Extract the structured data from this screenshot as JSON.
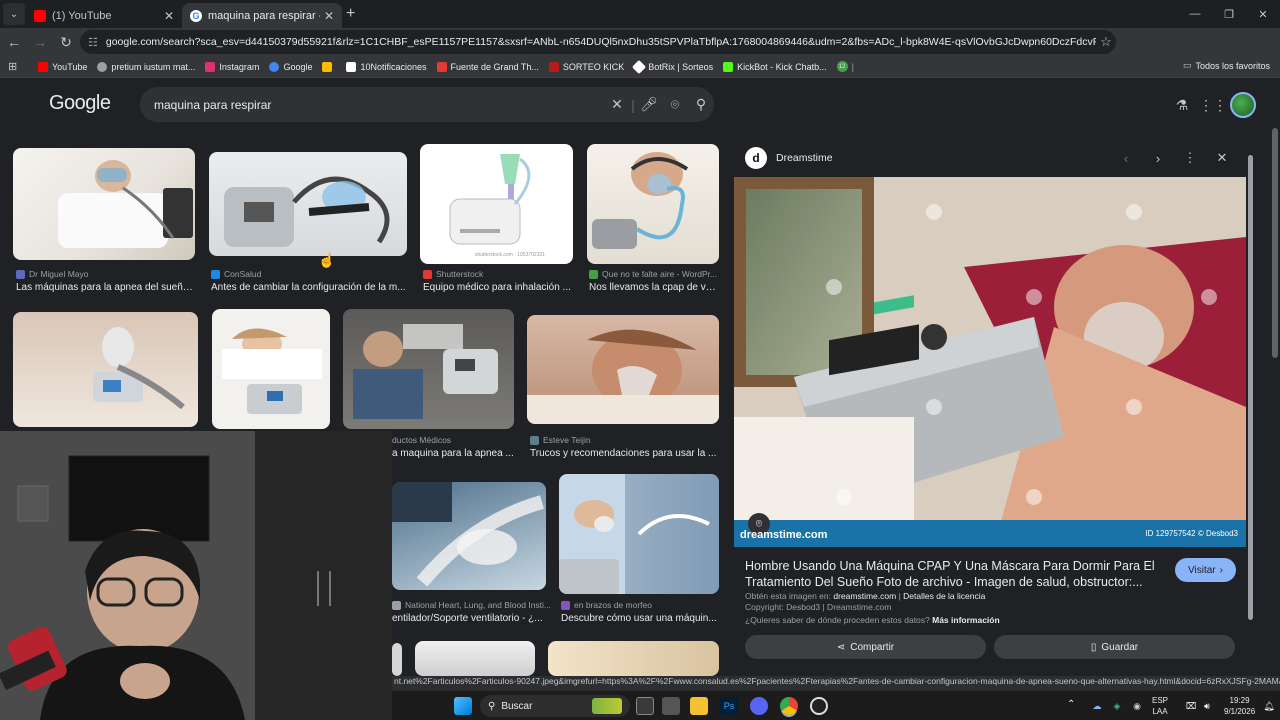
{
  "browser": {
    "tabs": [
      {
        "title": "(1) YouTube",
        "favicon_color": "#ff0000"
      },
      {
        "title": "maquina para respirar - Buscar",
        "favicon_color": "#4285f4"
      }
    ],
    "new_tab": "+",
    "url": "google.com/search?sca_esv=d44150379d55921f&rlz=1C1CHBF_esPE1157PE1157&sxsrf=ANbL-n654DUQl5nxDhu35tSPVPlaTbflpA:1768004869446&udm=2&fbs=ADc_l-bpk8W4E-qsVlOvbGJcDwpn60DczFdcvPnuv8WQohHLTa-EmKihfPCc..."
  },
  "bookmarks": [
    {
      "label": "YouTube",
      "color": "#ff0000"
    },
    {
      "label": "pretium iustum mat...",
      "color": "#9aa0a6"
    },
    {
      "label": "Instagram",
      "color": "#e1306c"
    },
    {
      "label": "Google",
      "color": "#4285f4"
    },
    {
      "label": "",
      "color": "#fbbc04"
    },
    {
      "label": "10Notificaciones",
      "color": "#ffffff"
    },
    {
      "label": "Fuente de Grand Th...",
      "color": "#e53935"
    },
    {
      "label": "SORTEO KICK",
      "color": "#b71c1c"
    },
    {
      "label": "BotRix | Sorteos",
      "color": "#ffffff"
    },
    {
      "label": "KickBot - Kick Chatb...",
      "color": "#53fc18"
    },
    {
      "label": "",
      "color": "#43a047"
    }
  ],
  "bookmarks_badge": "12",
  "bookmarks_all": "Todos los favoritos",
  "google": {
    "logo": "Google",
    "query": "maquina para respirar"
  },
  "results": [
    {
      "source": "Dr Miguel Mayo",
      "caption": "Las máquinas para la apnea del sueño...",
      "src_color": "#5c6bc0"
    },
    {
      "source": "ConSalud",
      "caption": "Antes de cambiar la configuración de la m...",
      "src_color": "#1e88e5"
    },
    {
      "source": "Shutterstock",
      "caption": "Equipo médico para inhalación ...",
      "src_color": "#e53935"
    },
    {
      "source": "Que no te falte aire - WordPr...",
      "caption": "Nos llevamos la cpap de va...",
      "src_color": "#43a047"
    },
    {
      "source": "ductos Médicos",
      "caption": "a maquina para la apnea ...",
      "src_color": "#9aa0a6"
    },
    {
      "source": "Esteve Teijin",
      "caption": "Trucos y recomendaciones para usar la ...",
      "src_color": "#607d8b"
    },
    {
      "source": "National Heart, Lung, and Blood Insti...",
      "caption": "entilador/Soporte ventilatorio - ¿...",
      "src_color": "#9aa0a6"
    },
    {
      "source": "en brazos de morfeo",
      "caption": "Descubre cómo usar una máquin...",
      "src_color": "#7e57c2"
    }
  ],
  "panel": {
    "site": "Dreamstime",
    "site_logo": "d",
    "watermark": "dreamstime.com",
    "image_id": "ID 129757542 © Desbod3",
    "title": "Hombre Usando Una Máquina CPAP Y Una Máscara Para Dormir Para El Tratamiento Del Sueño Foto de archivo - Imagen de salud, obstructor:...",
    "visit": "Visitar",
    "obtain_prefix": "Obtén esta imagen en: ",
    "obtain_site": "dreamstime.com",
    "obtain_sep": " | ",
    "license": "Detalles de la licencia",
    "copyright": "Copyright: Desbod3 | Dreamstime.com",
    "origin_q": "¿Quieres saber de dónde proceden estos datos? ",
    "more_info": "Más información",
    "share": "Compartir",
    "save": "Guardar"
  },
  "status_url": "nt.net%2Farticulos%2Farticulos-90247.jpeg&imgrefurl=https%3A%2F%2Fwww.consalud.es%2Fpacientes%2Fterapias%2Fantes-de-cambiar-configuracion-maquina-de-apnea-sueno-que-alternativas-hay.html&docid=6zRxXJSFg-2MAM&tbnid=...",
  "taskbar": {
    "search": "Buscar",
    "lang": "ESP",
    "lang2": "LAA",
    "time": "19:29",
    "date": "9/1/2026"
  }
}
